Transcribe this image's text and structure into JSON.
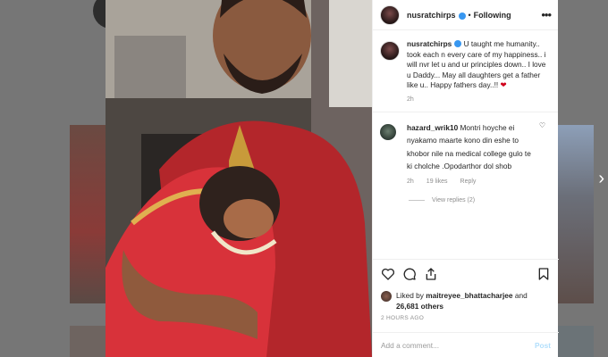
{
  "post": {
    "username": "nusratchirps",
    "following_label": "Following",
    "more_icon": "more-options-icon",
    "caption_username": "nusratchirps",
    "caption_text": "U taught me humanity.. took each n every care of my happiness.. i will nvr let u and ur principles down.. I love u Daddy... May all daughters get a father like u.. Happy fathers day..!!",
    "caption_time": "2h",
    "comment": {
      "username": "hazard_wrik10",
      "text": "Montri hoyche ei nyakamo maarte kono din eshe to khobor nile na medical college gulo te ki cholche .Opodarthor dol shob",
      "time": "2h",
      "likes": "19 likes",
      "reply": "Reply",
      "view_replies": "View replies (2)"
    },
    "likes": {
      "prefix": "Liked by",
      "user": "maitreyee_bhattacharjee",
      "and": "and",
      "count": "26,681 others"
    },
    "posted_ago": "2 HOURS AGO",
    "add_comment_placeholder": "Add a comment...",
    "post_button": "Post"
  },
  "colors": {
    "verified": "#3897f0",
    "heart": "#d0021b",
    "post_button": "#b2dffc"
  }
}
